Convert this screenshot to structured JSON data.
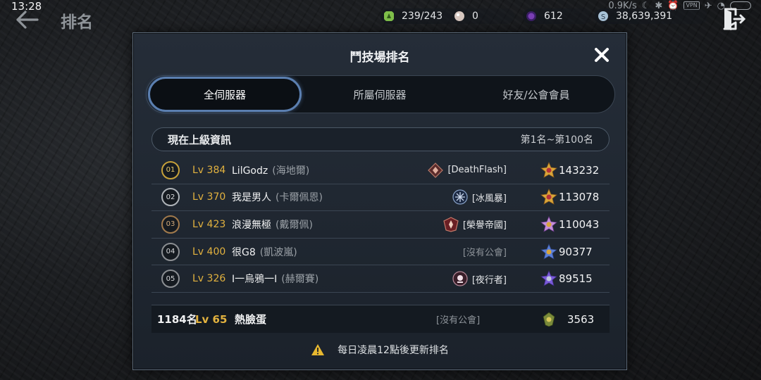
{
  "status_bar": {
    "time": "13:28",
    "net_speed": "0.9K/s",
    "vpn": "VPN"
  },
  "header": {
    "title": "排名"
  },
  "currencies": [
    {
      "name": "stamina",
      "icon": "stamina-icon",
      "value": "239/243",
      "color": "#7fbf4a"
    },
    {
      "name": "pearl",
      "icon": "pearl-icon",
      "value": "0",
      "color": "#d8c8c0"
    },
    {
      "name": "crystal",
      "icon": "crystal-icon",
      "value": "612",
      "color": "#7b3fb5"
    },
    {
      "name": "silver",
      "icon": "silver-coin-icon",
      "value": "38,639,391",
      "color": "#a9c3d8"
    }
  ],
  "panel": {
    "title": "鬥技場排名",
    "tabs": [
      {
        "label": "全伺服器",
        "active": true
      },
      {
        "label": "所屬伺服器",
        "active": false
      },
      {
        "label": "好友/公會會員",
        "active": false
      }
    ],
    "info_label": "現在上級資訊",
    "range_label": "第1名~第100名",
    "rows": [
      {
        "rank": "01",
        "medal": "gold",
        "level": "Lv 384",
        "name": "LilGodz",
        "class": "(海地爾)",
        "guild": "[DeathFlash]",
        "guild_icon": "guild-emblem-icon",
        "score": "143232"
      },
      {
        "rank": "02",
        "medal": "silver",
        "level": "Lv 370",
        "name": "我是男人",
        "class": "(卡爾佩恩)",
        "guild": "[冰風暴]",
        "guild_icon": "guild-emblem-icon",
        "score": "113078"
      },
      {
        "rank": "03",
        "medal": "bronze",
        "level": "Lv 423",
        "name": "浪漫無極",
        "class": "(戴爾佩)",
        "guild": "[榮譽帝國]",
        "guild_icon": "guild-emblem-icon",
        "score": "110043"
      },
      {
        "rank": "04",
        "medal": "plain",
        "level": "Lv 400",
        "name": "很G8",
        "class": "(凱波嵐)",
        "guild": "[沒有公會]",
        "guild_icon": "",
        "score": "90377"
      },
      {
        "rank": "05",
        "medal": "plain",
        "level": "Lv 326",
        "name": "I一烏鴉一I",
        "class": "(赫爾賽)",
        "guild": "[夜行者]",
        "guild_icon": "guild-emblem-icon",
        "score": "89515"
      }
    ],
    "my_row": {
      "rank": "1184名",
      "level": "Lv 65",
      "name": "熱臉蛋",
      "guild": "[沒有公會]",
      "score": "3563"
    },
    "notice": "每日凌晨12點後更新排名"
  }
}
